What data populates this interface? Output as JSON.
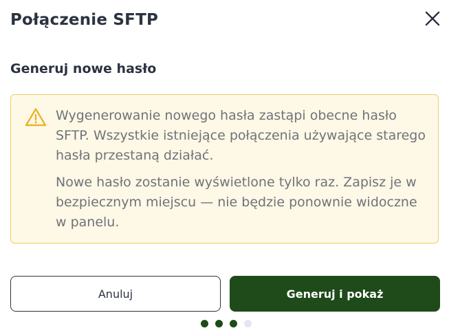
{
  "dialog": {
    "title": "Połączenie SFTP",
    "close_icon": "close-icon"
  },
  "section": {
    "title": "Generuj nowe hasło"
  },
  "warning": {
    "icon": "warning-triangle-icon",
    "paragraph_1": "Wygenerowanie nowego hasła zastąpi obecne hasło SFTP. Wszystkie istniejące połączenia używające starego hasła przestaną działać.",
    "paragraph_2": "Nowe hasło zostanie wyświetlone tylko raz. Zapisz je w bezpiecznym miejscu — nie będzie ponownie widoczne w panelu.",
    "background_color": "#fef8e6",
    "border_color": "#eccd63",
    "icon_color": "#e8b42a"
  },
  "actions": {
    "cancel_label": "Anuluj",
    "confirm_label": "Generuj i pokaż",
    "confirm_color": "#1f4a1a"
  },
  "progress": {
    "total_steps": 4,
    "current_step": 3
  }
}
